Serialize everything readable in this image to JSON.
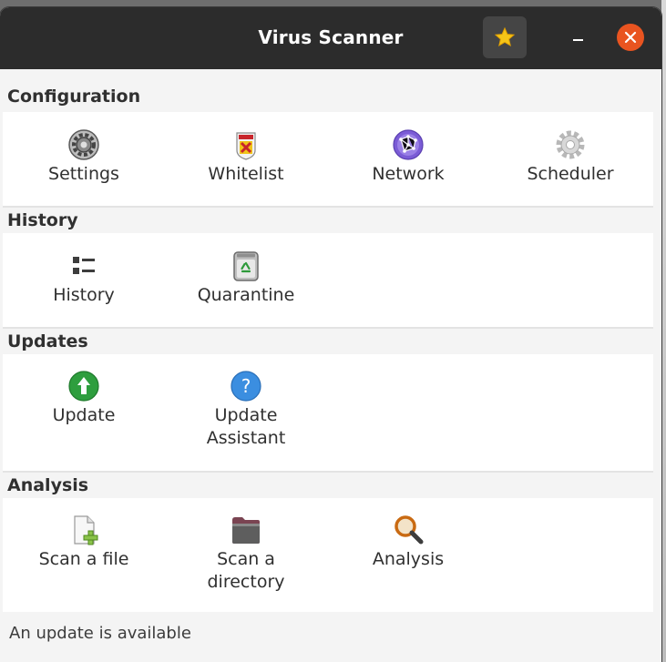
{
  "window": {
    "title": "Virus Scanner",
    "controls": {
      "pin_icon": "star-icon",
      "minimize_icon": "minimize-icon",
      "close_icon": "close-icon",
      "close_color": "#e95420"
    }
  },
  "sections": [
    {
      "header": "Configuration",
      "items": [
        {
          "label": "Settings",
          "icon": "gear-dark-icon"
        },
        {
          "label": "Whitelist",
          "icon": "whitelist-shield-icon"
        },
        {
          "label": "Network",
          "icon": "network-globe-icon"
        },
        {
          "label": "Scheduler",
          "icon": "gear-light-icon"
        }
      ]
    },
    {
      "header": "History",
      "items": [
        {
          "label": "History",
          "icon": "list-icon"
        },
        {
          "label": "Quarantine",
          "icon": "recycle-bin-icon"
        }
      ]
    },
    {
      "header": "Updates",
      "items": [
        {
          "label": "Update",
          "icon": "arrow-up-circle-icon"
        },
        {
          "label": "Update\nAssistant",
          "icon": "help-circle-icon"
        }
      ]
    },
    {
      "header": "Analysis",
      "items": [
        {
          "label": "Scan a file",
          "icon": "file-add-icon"
        },
        {
          "label": "Scan a\ndirectory",
          "icon": "folder-icon"
        },
        {
          "label": "Analysis",
          "icon": "magnifier-icon"
        }
      ]
    }
  ],
  "status_bar": {
    "text": "An update is available"
  }
}
